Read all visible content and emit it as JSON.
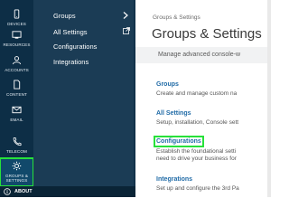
{
  "rail": {
    "items": [
      {
        "label": "DEVICES",
        "icon": "devices-icon"
      },
      {
        "label": "RESOURCES",
        "icon": "resources-icon"
      },
      {
        "label": "ACCOUNTS",
        "icon": "accounts-icon"
      },
      {
        "label": "CONTENT",
        "icon": "content-icon"
      },
      {
        "label": "EMAIL",
        "icon": "email-icon"
      },
      {
        "label": "TELECOM",
        "icon": "telecom-icon"
      },
      {
        "label_line1": "GROUPS &",
        "label_line2": "SETTINGS",
        "icon": "gear-icon",
        "active": true
      }
    ],
    "about": "ABOUT"
  },
  "subnav": {
    "items": [
      "Groups",
      "All Settings",
      "Configurations",
      "Integrations"
    ]
  },
  "main": {
    "breadcrumb": "Groups & Settings",
    "title": "Groups & Settings",
    "intro": "Manage advanced console-w",
    "sections": [
      {
        "link": "Groups",
        "desc": "Create and manage custom na"
      },
      {
        "link": "All Settings",
        "desc": "Setup, installation, Console sett"
      },
      {
        "link": "Configurations",
        "desc1": "Establish the foundational setti",
        "desc2": "need to drive your business for"
      },
      {
        "link": "Integrations",
        "desc": "Set up and configure the 3rd Pa"
      }
    ]
  },
  "colors": {
    "rail_bg": "#0d2e46",
    "subnav_bg": "#1b3c55",
    "link": "#1f6aa6",
    "highlight": "#27e13a"
  }
}
